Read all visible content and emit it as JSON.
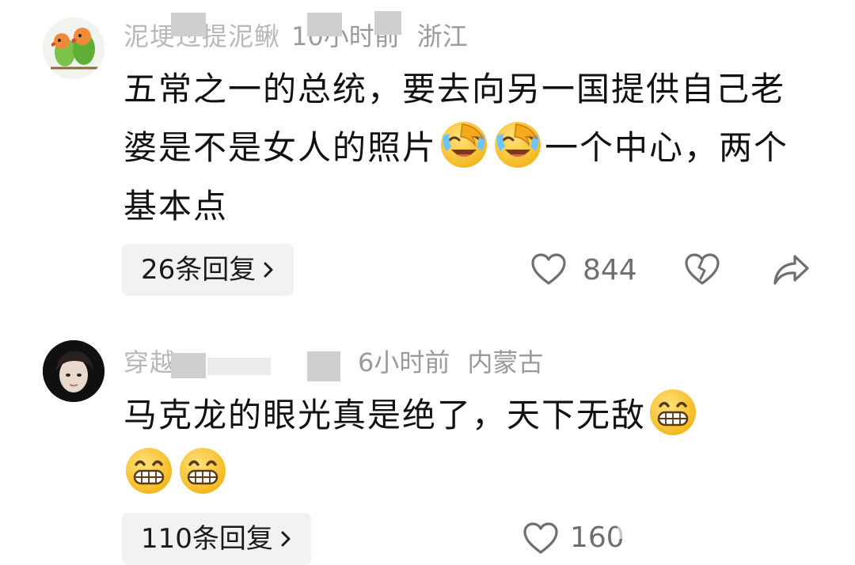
{
  "comments": [
    {
      "username": "泥埂过提泥鳅",
      "time": "10小时前",
      "location": "浙江",
      "avatar_icon": "parrots-avatar",
      "text_parts": [
        "五常之一的总统，要去向另一国提供自己老婆是不是女人的照片",
        "一个中心，两个基本点"
      ],
      "emojis": [
        "facepalm-laugh-emoji",
        "facepalm-laugh-emoji"
      ],
      "reply_label": "26条回复",
      "like_count": "844"
    },
    {
      "username": "穿越",
      "time": "6小时前",
      "location": "内蒙古",
      "avatar_icon": "person-avatar",
      "text": "马克龙的眼光真是绝了，天下无敌",
      "emojis": [
        "grin-emoji",
        "grin-emoji",
        "grin-emoji"
      ],
      "reply_label": "110条回复",
      "like_count": "160"
    }
  ],
  "colors": {
    "text": "#111111",
    "meta": "#9a9a9a",
    "reply_bg": "#f2f2f2",
    "icon": "#6f6f6f",
    "emoji_yellow": "#f7c531"
  }
}
